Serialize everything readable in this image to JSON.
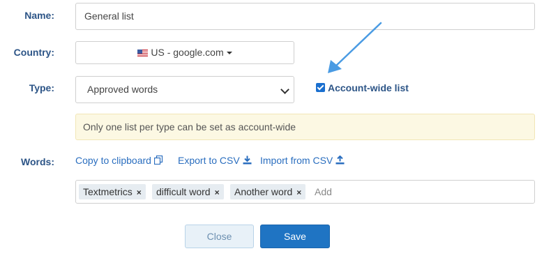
{
  "form": {
    "name_label": "Name:",
    "name_value": "General list",
    "country_label": "Country:",
    "country_value": "US - google.com",
    "type_label": "Type:",
    "type_value": "Approved words",
    "account_wide_label": "Account-wide list",
    "account_wide_checked": true,
    "notice": "Only one list per type can be set as account-wide",
    "words_label": "Words:"
  },
  "actions": {
    "copy": "Copy to clipboard",
    "export": "Export to CSV",
    "import": "Import from CSV"
  },
  "tags": [
    "Textmetrics",
    "difficult word",
    "Another word"
  ],
  "tag_remove_glyph": "×",
  "tag_input_placeholder": "Add",
  "buttons": {
    "close": "Close",
    "save": "Save"
  },
  "colors": {
    "label": "#2d5587",
    "link": "#2a6ebf",
    "primary": "#1f74c3",
    "notice_bg": "#fcf8e3",
    "annotation_arrow": "#4a9be3"
  }
}
